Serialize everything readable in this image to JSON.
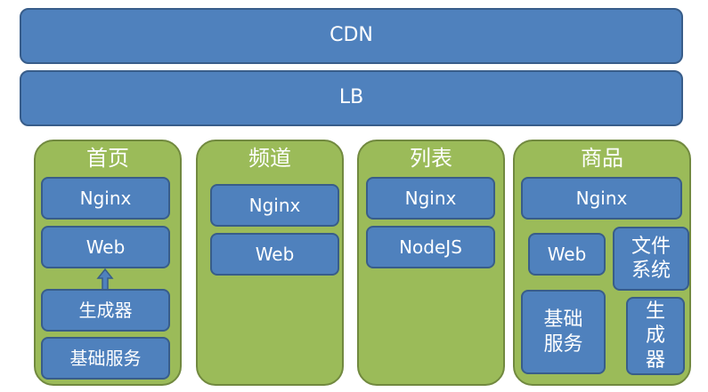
{
  "top_layers": {
    "cdn": "CDN",
    "lb": "LB"
  },
  "panels": {
    "home": {
      "title": "首页",
      "nginx": "Nginx",
      "web": "Web",
      "generator": "生成器",
      "base_service": "基础服务"
    },
    "channel": {
      "title": "频道",
      "nginx": "Nginx",
      "web": "Web"
    },
    "list": {
      "title": "列表",
      "nginx": "Nginx",
      "nodejs": "NodeJS"
    },
    "product": {
      "title": "商品",
      "nginx": "Nginx",
      "web": "Web",
      "file_system": "文件\n系统",
      "base_service": "基础\n服务",
      "generator": "生\n成\n器"
    }
  },
  "colors": {
    "blue_fill": "#4f81bd",
    "blue_border": "#385d8a",
    "green_fill": "#9bbb59",
    "green_border": "#71893f",
    "text": "#ffffff"
  }
}
